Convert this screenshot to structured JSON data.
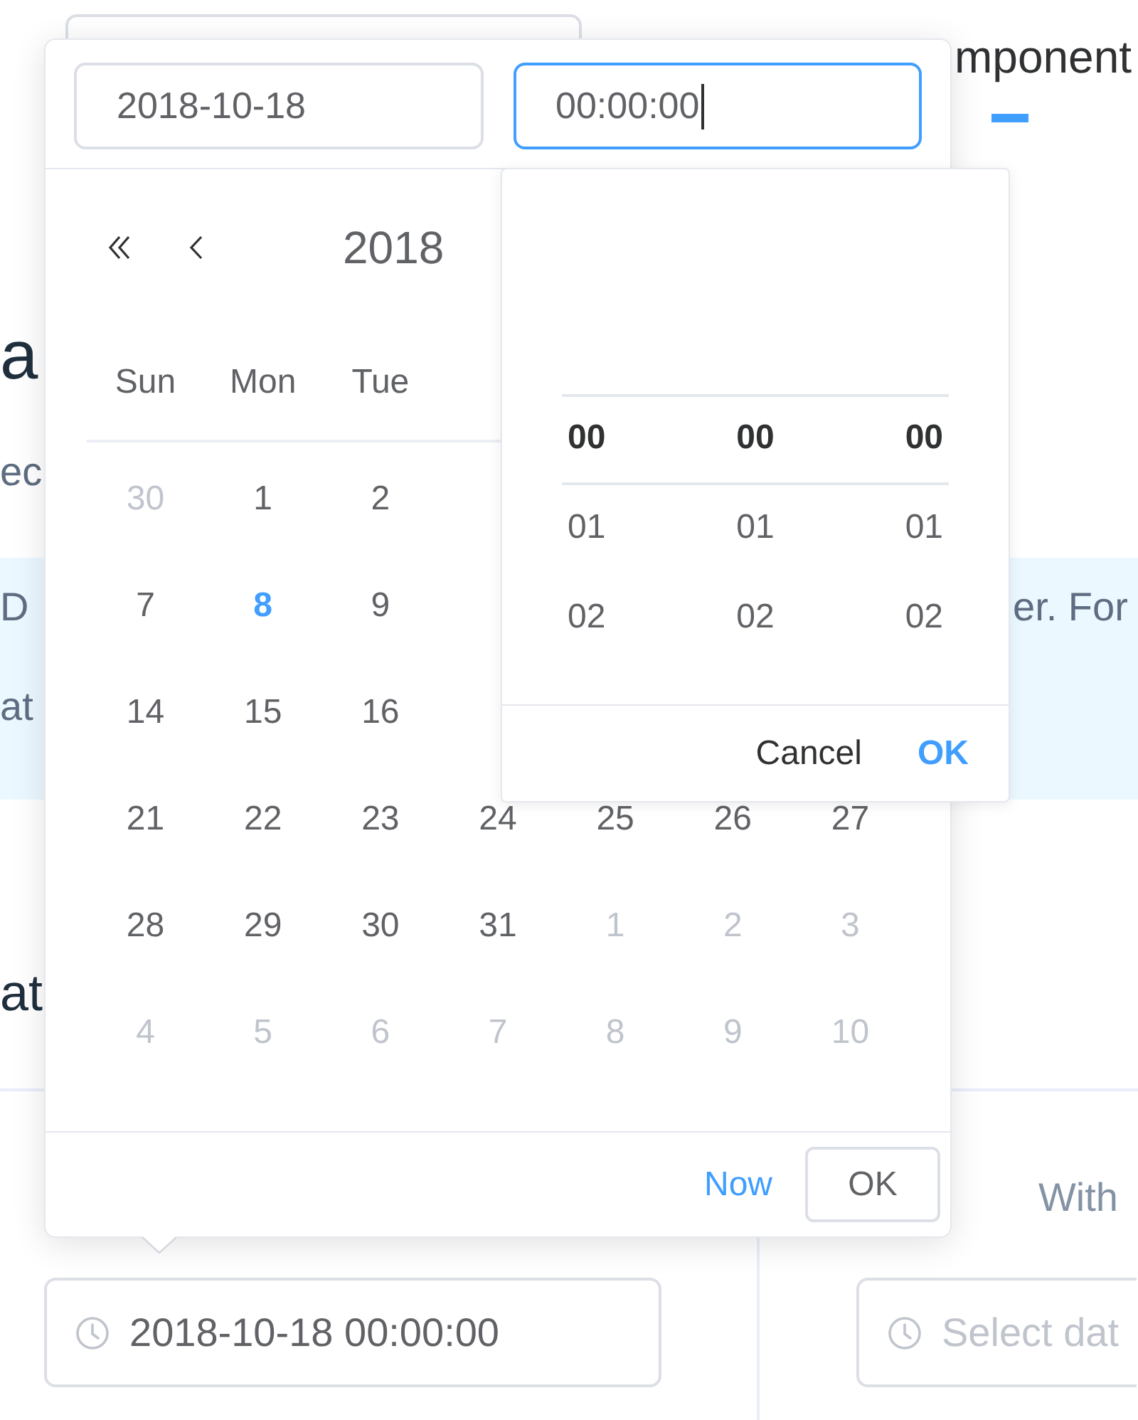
{
  "page": {
    "tab": {
      "label": "mponent",
      "selected": true
    },
    "heading_1": "a",
    "description": "ec",
    "tip": {
      "line_1_left": "D",
      "line_1_right": "er. For",
      "line_2_left": "at"
    },
    "heading_2": "at",
    "demo_1_input": {
      "value": "2018-10-18 00:00:00"
    },
    "demo_2_label": "With",
    "demo_2_input": {
      "placeholder": "Select dat"
    }
  },
  "picker": {
    "date_input": {
      "value": "2018-10-18"
    },
    "time_input": {
      "value": "00:00:00",
      "focused": true
    },
    "year": "2018",
    "weekdays": [
      "Sun",
      "Mon",
      "Tue"
    ],
    "weeks": [
      [
        {
          "day": "30",
          "outside": true,
          "today": false
        },
        {
          "day": "1",
          "outside": false,
          "today": false
        },
        {
          "day": "2",
          "outside": false,
          "today": false
        }
      ],
      [
        {
          "day": "7",
          "outside": false,
          "today": false
        },
        {
          "day": "8",
          "outside": false,
          "today": true
        },
        {
          "day": "9",
          "outside": false,
          "today": false
        }
      ],
      [
        {
          "day": "14",
          "outside": false,
          "today": false
        },
        {
          "day": "15",
          "outside": false,
          "today": false
        },
        {
          "day": "16",
          "outside": false,
          "today": false
        }
      ],
      [
        {
          "day": "21",
          "outside": false,
          "today": false
        },
        {
          "day": "22",
          "outside": false,
          "today": false
        },
        {
          "day": "23",
          "outside": false,
          "today": false
        },
        {
          "day": "24",
          "outside": false,
          "today": false
        },
        {
          "day": "25",
          "outside": false,
          "today": false
        },
        {
          "day": "26",
          "outside": false,
          "today": false
        },
        {
          "day": "27",
          "outside": false,
          "today": false
        }
      ],
      [
        {
          "day": "28",
          "outside": false,
          "today": false
        },
        {
          "day": "29",
          "outside": false,
          "today": false
        },
        {
          "day": "30",
          "outside": false,
          "today": false
        },
        {
          "day": "31",
          "outside": false,
          "today": false
        },
        {
          "day": "1",
          "outside": true,
          "today": false
        },
        {
          "day": "2",
          "outside": true,
          "today": false
        },
        {
          "day": "3",
          "outside": true,
          "today": false
        }
      ],
      [
        {
          "day": "4",
          "outside": true,
          "today": false
        },
        {
          "day": "5",
          "outside": true,
          "today": false
        },
        {
          "day": "6",
          "outside": true,
          "today": false
        },
        {
          "day": "7",
          "outside": true,
          "today": false
        },
        {
          "day": "8",
          "outside": true,
          "today": false
        },
        {
          "day": "9",
          "outside": true,
          "today": false
        },
        {
          "day": "10",
          "outside": true,
          "today": false
        }
      ]
    ],
    "footer": {
      "now": "Now",
      "ok": "OK"
    }
  },
  "time_panel": {
    "columns": [
      [
        {
          "text": "00",
          "selected": true
        },
        {
          "text": "01",
          "selected": false
        },
        {
          "text": "02",
          "selected": false
        }
      ],
      [
        {
          "text": "00",
          "selected": true
        },
        {
          "text": "01",
          "selected": false
        },
        {
          "text": "02",
          "selected": false
        }
      ],
      [
        {
          "text": "00",
          "selected": true
        },
        {
          "text": "01",
          "selected": false
        },
        {
          "text": "02",
          "selected": false
        }
      ]
    ],
    "cancel": "Cancel",
    "ok": "OK"
  }
}
